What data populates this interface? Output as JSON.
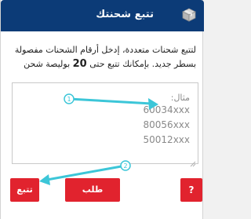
{
  "header": {
    "title": "تتبع شحنتك",
    "icon": "package-icon"
  },
  "description": {
    "line1": "لتتبع شحنات متعددة، إدخل أرقام الشحنات مفصولة",
    "line2_prefix": "بسطر جديد. بإمكانك تتبع حتى",
    "line2_number": "20",
    "line2_suffix": "بوليصة شحن"
  },
  "tracking_input": {
    "example_label": "مثال:",
    "example_lines": [
      "60034xxx",
      "80056xxx",
      "50012xxx"
    ]
  },
  "buttons": {
    "track_label": "تتبع",
    "request_label": "طلب إشعارات",
    "help_label": "?"
  },
  "annotations": {
    "step1": "1",
    "step2": "2",
    "arrow_color": "#3cc6d8"
  },
  "colors": {
    "header_bg": "#0c3b77",
    "button_bg": "#e1232e"
  }
}
